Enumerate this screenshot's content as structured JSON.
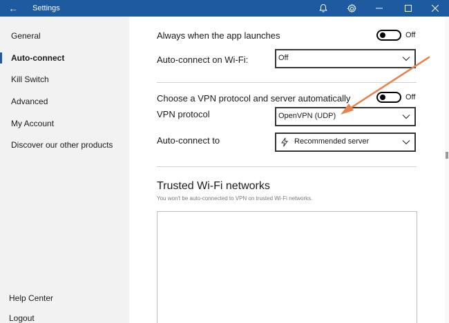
{
  "titlebar": {
    "title": "Settings",
    "icons": [
      "back-arrow-icon",
      "bell-icon",
      "gear-icon",
      "minimize-icon",
      "maximize-icon",
      "close-icon"
    ],
    "color": "#1e5aa0"
  },
  "sidebar": {
    "items": [
      {
        "label": "General"
      },
      {
        "label": "Auto-connect",
        "active": true
      },
      {
        "label": "Kill Switch"
      },
      {
        "label": "Advanced"
      },
      {
        "label": "My Account"
      },
      {
        "label": "Discover our other products"
      }
    ],
    "help_center": "Help Center",
    "logout": "Logout"
  },
  "main": {
    "always_launch": {
      "label": "Always when the app launches",
      "toggle_state": "Off"
    },
    "wifi": {
      "label": "Auto-connect on Wi-Fi:",
      "value": "Off"
    },
    "choose_protocol": {
      "label": "Choose a VPN protocol and server automatically",
      "toggle_state": "Off"
    },
    "vpn_protocol": {
      "label": "VPN protocol",
      "value": "OpenVPN (UDP)"
    },
    "auto_connect_to": {
      "label": "Auto-connect to",
      "value": "Recommended server",
      "icon": "lightning-icon"
    },
    "trusted": {
      "title": "Trusted Wi-Fi networks",
      "subtitle": "You won't be auto-connected to VPN on trusted Wi-Fi networks."
    }
  },
  "annotation": {
    "color": "#e8834f"
  }
}
